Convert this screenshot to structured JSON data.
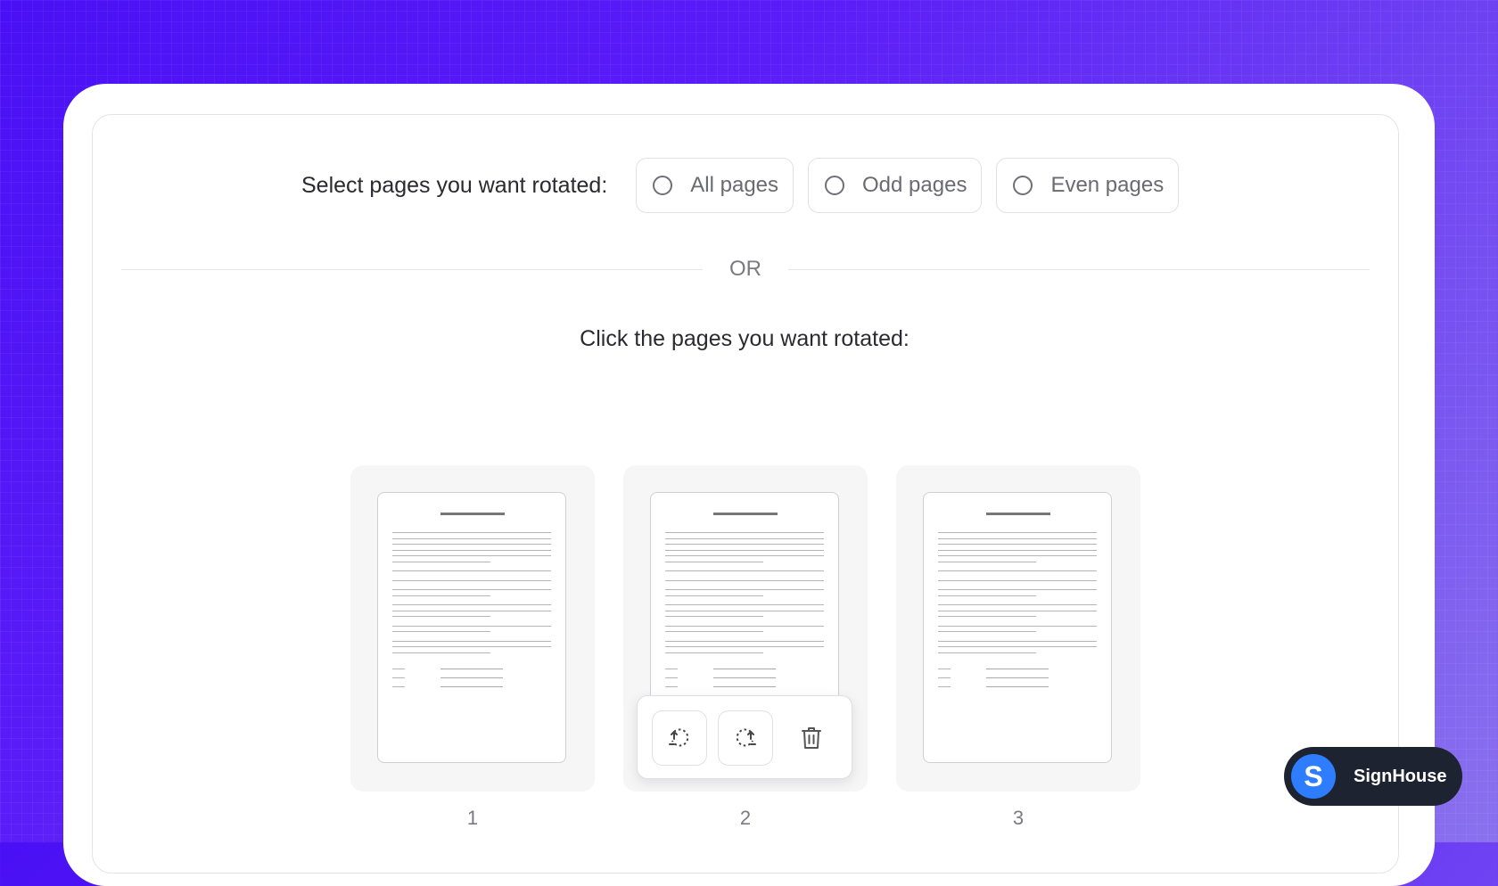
{
  "rotate_selection": {
    "label": "Select pages you want rotated:",
    "options": [
      {
        "label": "All pages"
      },
      {
        "label": "Odd pages"
      },
      {
        "label": "Even pages"
      }
    ]
  },
  "divider_text": "OR",
  "click_label": "Click the pages you want rotated:",
  "pages": [
    {
      "number": "1"
    },
    {
      "number": "2"
    },
    {
      "number": "3"
    }
  ],
  "page_toolbar": {
    "icons": [
      "rotate-left-icon",
      "rotate-right-icon",
      "trash-icon"
    ]
  },
  "brand_badge": {
    "logo_letter": "S",
    "name": "SignHouse"
  },
  "colors": {
    "background_gradient_start": "#4a10f5",
    "background_gradient_end": "#8a72ee",
    "badge_bg": "#1d2330",
    "badge_logo": "#2f7dff"
  }
}
